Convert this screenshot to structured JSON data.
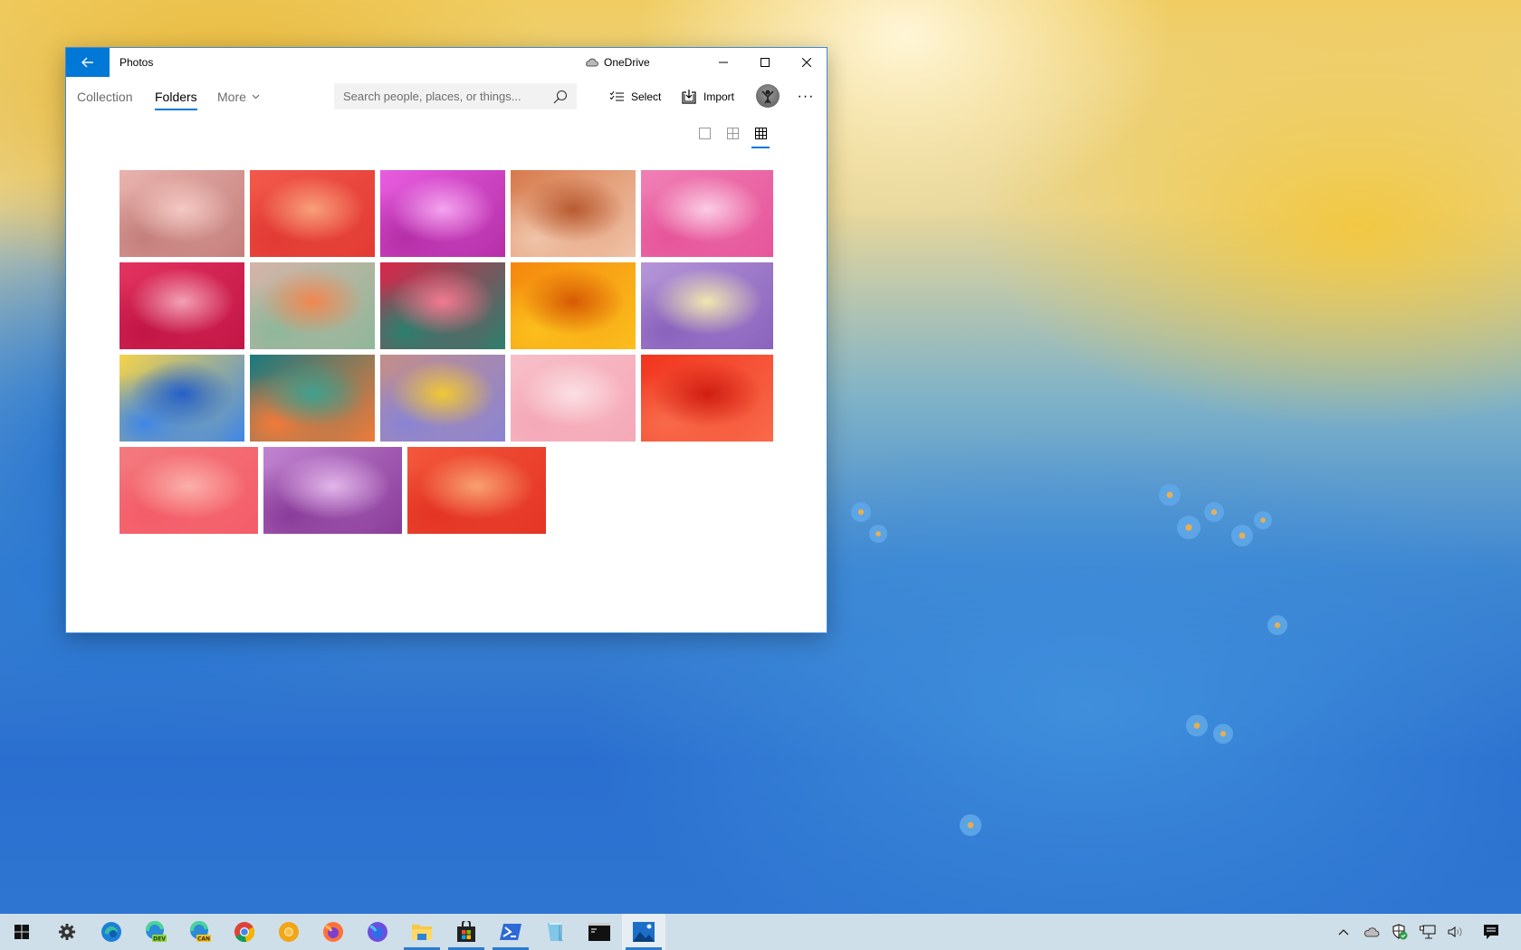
{
  "window": {
    "app_title": "Photos",
    "onedrive_label": "OneDrive",
    "nav": {
      "tabs": [
        {
          "label": "Collection",
          "active": false
        },
        {
          "label": "Folders",
          "active": true
        },
        {
          "label": "More",
          "active": false
        }
      ]
    },
    "search": {
      "placeholder": "Search people, places, or things...",
      "value": ""
    },
    "toolbar": {
      "select_label": "Select",
      "import_label": "Import",
      "more_label": "···"
    },
    "view_modes": [
      "large",
      "medium",
      "small"
    ],
    "active_view": "small",
    "photos": [
      {
        "row": 0,
        "colors": [
          "#e9b3ad",
          "#c47f7c",
          "#f4c9c4"
        ]
      },
      {
        "row": 0,
        "colors": [
          "#f2594a",
          "#e23a34",
          "#f8a07a"
        ]
      },
      {
        "row": 0,
        "colors": [
          "#e85de0",
          "#b52fa8",
          "#f5a3f0"
        ]
      },
      {
        "row": 0,
        "colors": [
          "#d77a4c",
          "#f0c3a8",
          "#b85a30"
        ]
      },
      {
        "row": 0,
        "colors": [
          "#f07fb4",
          "#e6559a",
          "#fbcde3"
        ]
      },
      {
        "row": 1,
        "colors": [
          "#e33360",
          "#c21646",
          "#f2a0b4"
        ]
      },
      {
        "row": 1,
        "colors": [
          "#d5b4a8",
          "#8fb79a",
          "#f08750"
        ]
      },
      {
        "row": 1,
        "colors": [
          "#d8264a",
          "#2b7f6e",
          "#f27a90"
        ]
      },
      {
        "row": 1,
        "colors": [
          "#f5870e",
          "#fbbf1c",
          "#d75a04"
        ]
      },
      {
        "row": 1,
        "colors": [
          "#b596d8",
          "#8a63bd",
          "#efe6b0"
        ]
      },
      {
        "row": 2,
        "colors": [
          "#f4d34a",
          "#3f86e6",
          "#2460c8"
        ]
      },
      {
        "row": 2,
        "colors": [
          "#1b7a7e",
          "#f07a3a",
          "#3fa08e"
        ]
      },
      {
        "row": 2,
        "colors": [
          "#c48e8a",
          "#8a84d4",
          "#f2c834"
        ]
      },
      {
        "row": 2,
        "colors": [
          "#f7bfc8",
          "#f5a9b8",
          "#fbe0e4"
        ]
      },
      {
        "row": 2,
        "colors": [
          "#f2341e",
          "#f86a4a",
          "#d01e12"
        ]
      },
      {
        "row": 3,
        "colors": [
          "#f37a7e",
          "#f45c68",
          "#fbb0aa"
        ]
      },
      {
        "row": 3,
        "colors": [
          "#c184d0",
          "#8a3c9a",
          "#e2b6ea"
        ]
      },
      {
        "row": 3,
        "colors": [
          "#f3573a",
          "#e43424",
          "#f8a070"
        ]
      }
    ]
  },
  "taskbar": {
    "items": [
      {
        "name": "start",
        "running": false,
        "active": false
      },
      {
        "name": "settings",
        "running": false,
        "active": false
      },
      {
        "name": "edge",
        "running": false,
        "active": false
      },
      {
        "name": "edge-dev",
        "badge": "DEV",
        "running": false,
        "active": false
      },
      {
        "name": "edge-canary",
        "badge": "CAN",
        "running": false,
        "active": false
      },
      {
        "name": "chrome",
        "running": false,
        "active": false
      },
      {
        "name": "chrome-canary",
        "running": false,
        "active": false
      },
      {
        "name": "firefox",
        "running": false,
        "active": false
      },
      {
        "name": "firefox-nightly",
        "running": false,
        "active": false
      },
      {
        "name": "file-explorer",
        "running": true,
        "active": false
      },
      {
        "name": "microsoft-store",
        "running": true,
        "active": false
      },
      {
        "name": "powershell",
        "running": true,
        "active": false
      },
      {
        "name": "notepad",
        "running": false,
        "active": false
      },
      {
        "name": "command-prompt",
        "running": false,
        "active": false
      },
      {
        "name": "photos",
        "running": true,
        "active": true
      }
    ],
    "tray": [
      "show-hidden-icons",
      "onedrive",
      "windows-security",
      "network",
      "volume",
      "action-center"
    ]
  }
}
